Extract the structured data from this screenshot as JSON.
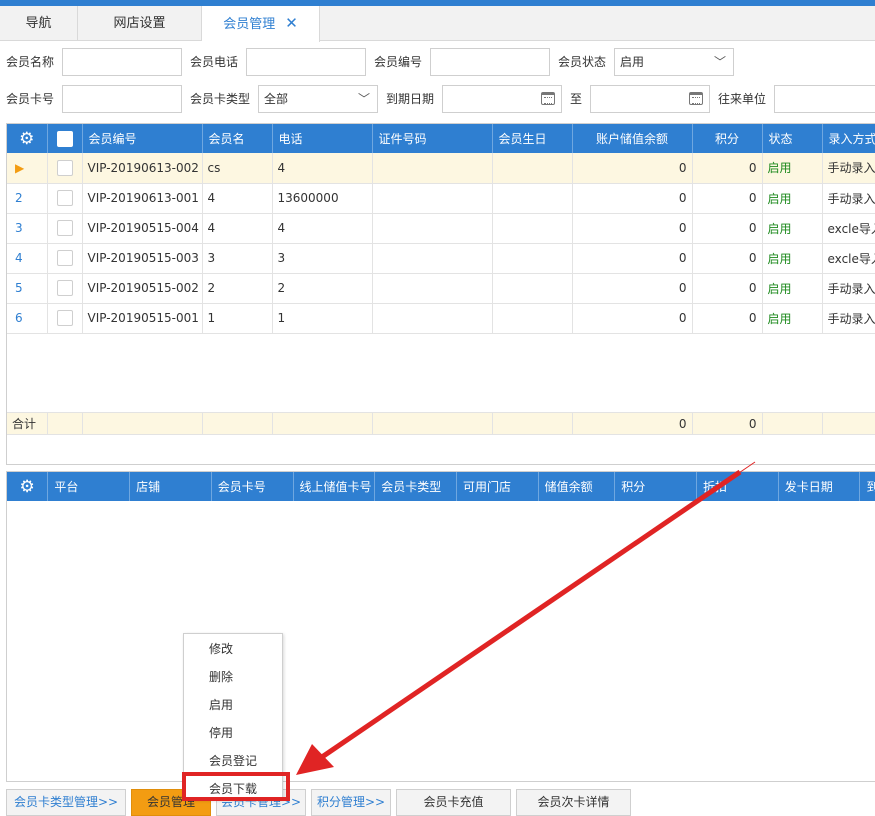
{
  "tabs": [
    {
      "label": "导航"
    },
    {
      "label": "网店设置"
    },
    {
      "label": "会员管理",
      "close": "✕"
    }
  ],
  "filters": {
    "member_name_label": "会员名称",
    "member_name_value": "",
    "phone_label": "会员电话",
    "phone_value": "",
    "member_no_label": "会员编号",
    "member_no_value": "",
    "status_label": "会员状态",
    "status_value": "启用",
    "card_no_label": "会员卡号",
    "card_no_value": "",
    "card_type_label": "会员卡类型",
    "card_type_value": "全部",
    "expiry_label": "到期日期",
    "expiry_from": "",
    "to_label": "至",
    "expiry_to": "",
    "partner_label": "往来单位",
    "partner_value": ""
  },
  "member_grid": {
    "columns": [
      "会员编号",
      "会员名",
      "电话",
      "证件号码",
      "会员生日",
      "账户储值余额",
      "积分",
      "状态",
      "录入方式"
    ],
    "rows": [
      {
        "idx": "▶",
        "no": "VIP-20190613-002",
        "name": "cs",
        "phone": "4",
        "id": "",
        "birthday": "",
        "balance": "0",
        "points": "0",
        "status": "启用",
        "entry": "手动录入"
      },
      {
        "idx": "2",
        "no": "VIP-20190613-001",
        "name": "4",
        "phone": "13600000",
        "id": "",
        "birthday": "",
        "balance": "0",
        "points": "0",
        "status": "启用",
        "entry": "手动录入"
      },
      {
        "idx": "3",
        "no": "VIP-20190515-004",
        "name": "4",
        "phone": "4",
        "id": "",
        "birthday": "",
        "balance": "0",
        "points": "0",
        "status": "启用",
        "entry": "excle导入"
      },
      {
        "idx": "4",
        "no": "VIP-20190515-003",
        "name": "3",
        "phone": "3",
        "id": "",
        "birthday": "",
        "balance": "0",
        "points": "0",
        "status": "启用",
        "entry": "excle导入"
      },
      {
        "idx": "5",
        "no": "VIP-20190515-002",
        "name": "2",
        "phone": "2",
        "id": "",
        "birthday": "",
        "balance": "0",
        "points": "0",
        "status": "启用",
        "entry": "手动录入"
      },
      {
        "idx": "6",
        "no": "VIP-20190515-001",
        "name": "1",
        "phone": "1",
        "id": "",
        "birthday": "",
        "balance": "0",
        "points": "0",
        "status": "启用",
        "entry": "手动录入"
      }
    ],
    "summary": {
      "label": "合计",
      "balance": "0",
      "points": "0"
    }
  },
  "card_grid": {
    "columns": [
      "平台",
      "店铺",
      "会员卡号",
      "线上储值卡号",
      "会员卡类型",
      "可用门店",
      "储值余额",
      "积分",
      "折扣",
      "发卡日期",
      "到期"
    ]
  },
  "context_menu": {
    "items": [
      "修改",
      "删除",
      "启用",
      "停用",
      "会员登记",
      "会员下载"
    ]
  },
  "buttons": {
    "card_type_mgmt": "会员卡类型管理>>",
    "member_mgmt": "会员管理",
    "hidden_mgmt": "会员卡管理>>",
    "points_mgmt": "积分管理>>",
    "card_recharge": "会员卡充值",
    "times_card_detail": "会员次卡详情"
  },
  "colors": {
    "header_blue": "#2f7fd1",
    "status_green": "#1e8a1e",
    "selected_row": "#fdf7e1",
    "orange_button": "#f39c12",
    "annotation_red": "#e02424"
  }
}
